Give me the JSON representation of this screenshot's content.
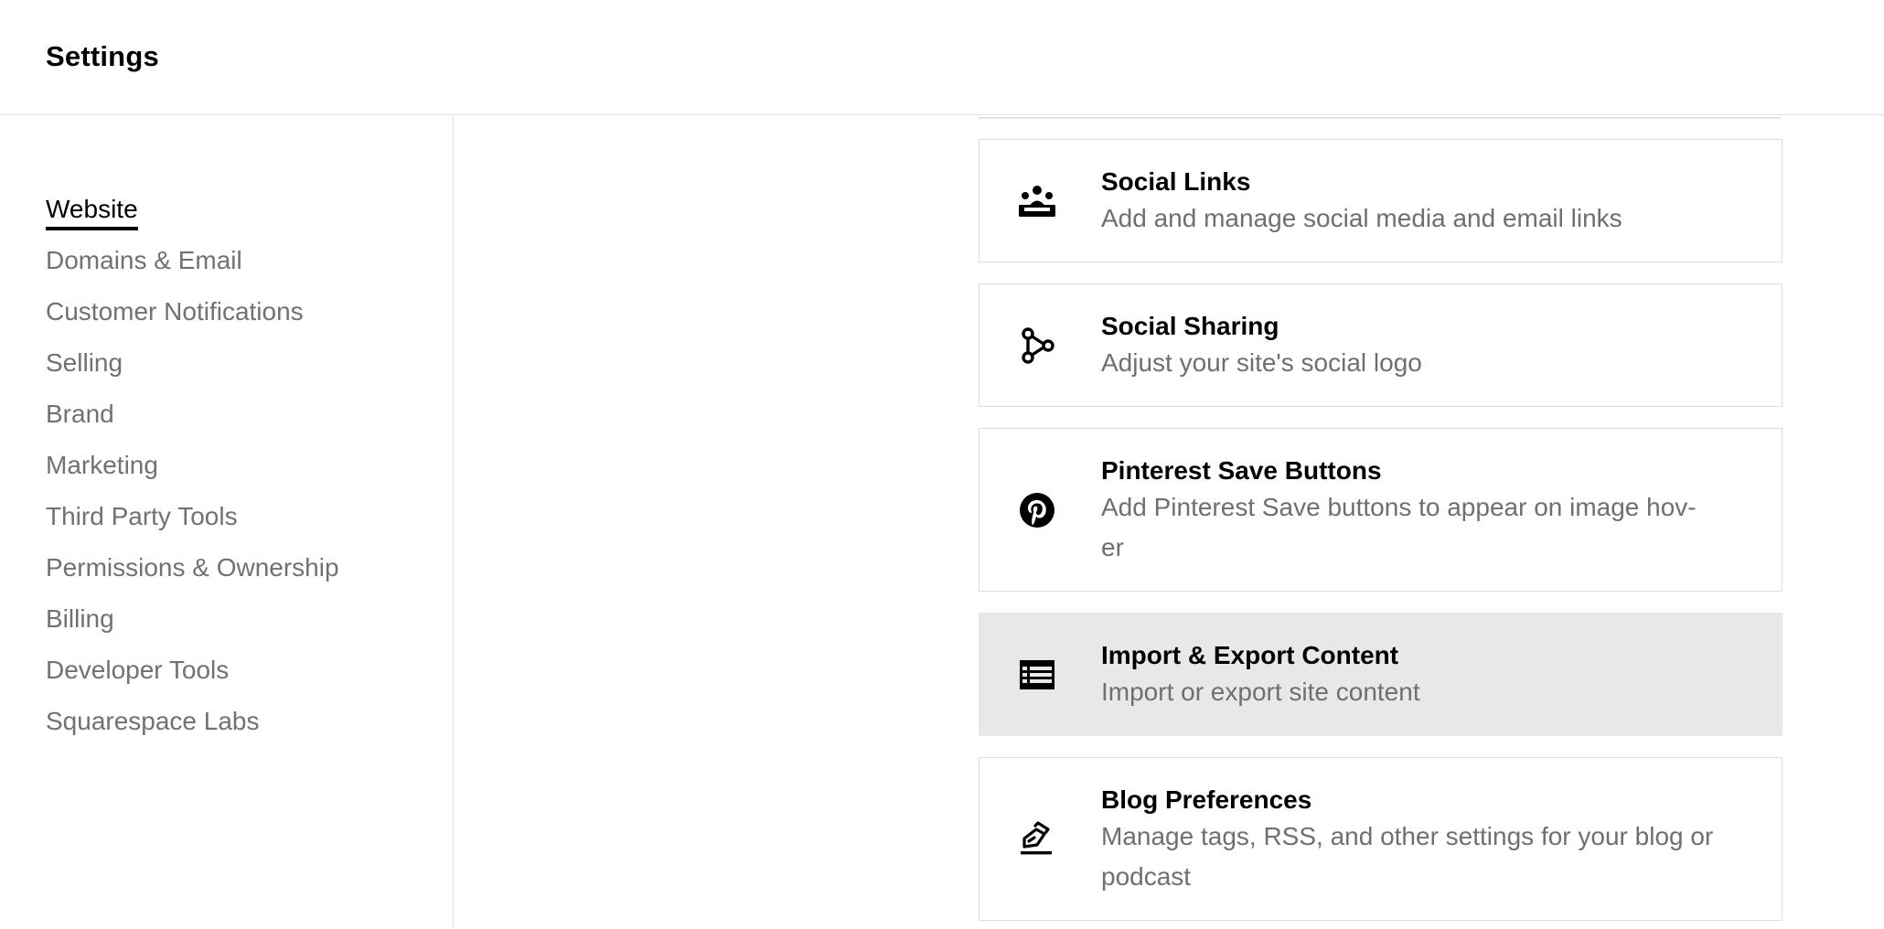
{
  "header": {
    "title": "Settings"
  },
  "sidebar": {
    "items": [
      {
        "label": "Website",
        "active": true
      },
      {
        "label": "Domains & Email",
        "active": false
      },
      {
        "label": "Customer Notifications",
        "active": false
      },
      {
        "label": "Selling",
        "active": false
      },
      {
        "label": "Brand",
        "active": false
      },
      {
        "label": "Marketing",
        "active": false
      },
      {
        "label": "Third Party Tools",
        "active": false
      },
      {
        "label": "Permissions & Ownership",
        "active": false
      },
      {
        "label": "Billing",
        "active": false
      },
      {
        "label": "Developer Tools",
        "active": false
      },
      {
        "label": "Squarespace Labs",
        "active": false
      }
    ]
  },
  "cards": [
    {
      "icon": "social-links-icon",
      "title": "Social Links",
      "desc": "Add and manage social media and email links",
      "highlighted": false
    },
    {
      "icon": "share-icon",
      "title": "Social Sharing",
      "desc": "Adjust your site's social logo",
      "highlighted": false
    },
    {
      "icon": "pinterest-icon",
      "title": "Pinterest Save Buttons",
      "desc": "Add Pinterest Save buttons to appear on image hov-\ner",
      "highlighted": false
    },
    {
      "icon": "table-icon",
      "title": "Import & Export Content",
      "desc": "Import or export site content",
      "highlighted": true
    },
    {
      "icon": "edit-icon",
      "title": "Blog Preferences",
      "desc": "Manage tags, RSS, and other settings for your blog or podcast",
      "highlighted": false
    }
  ],
  "colors": {
    "highlight_bg": "#e8e8e8",
    "muted_text": "#717171",
    "border": "#dcdcdc"
  }
}
